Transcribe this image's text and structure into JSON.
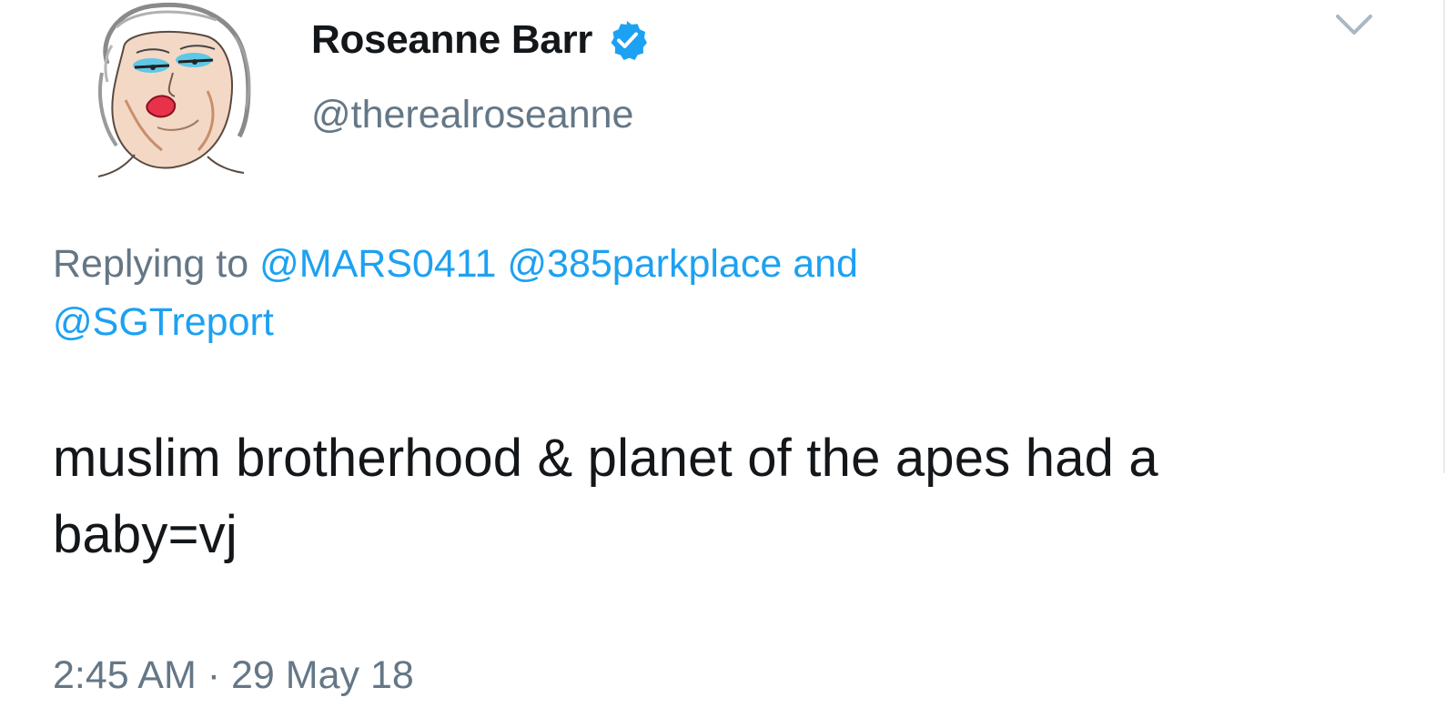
{
  "tweet": {
    "author": {
      "display_name": "Roseanne Barr",
      "handle": "@therealroseanne",
      "avatar_icon": "avatar-sketch-portrait",
      "verified_icon": "verified-badge-icon"
    },
    "reply_context": {
      "prefix": "Replying to",
      "mentions": [
        "@MARS0411",
        "@385parkplace"
      ],
      "connector": "and",
      "last_mention": "@SGTreport"
    },
    "text": "muslim brotherhood & planet of the apes had a baby=vj",
    "timestamp": {
      "time": "2:45 AM",
      "separator": "·",
      "date": "29 May 18"
    },
    "menu_icon": "chevron-down-icon"
  },
  "colors": {
    "text_primary": "#14171a",
    "text_secondary": "#657786",
    "link": "#1da1f2",
    "verified_badge": "#1da1f2"
  }
}
